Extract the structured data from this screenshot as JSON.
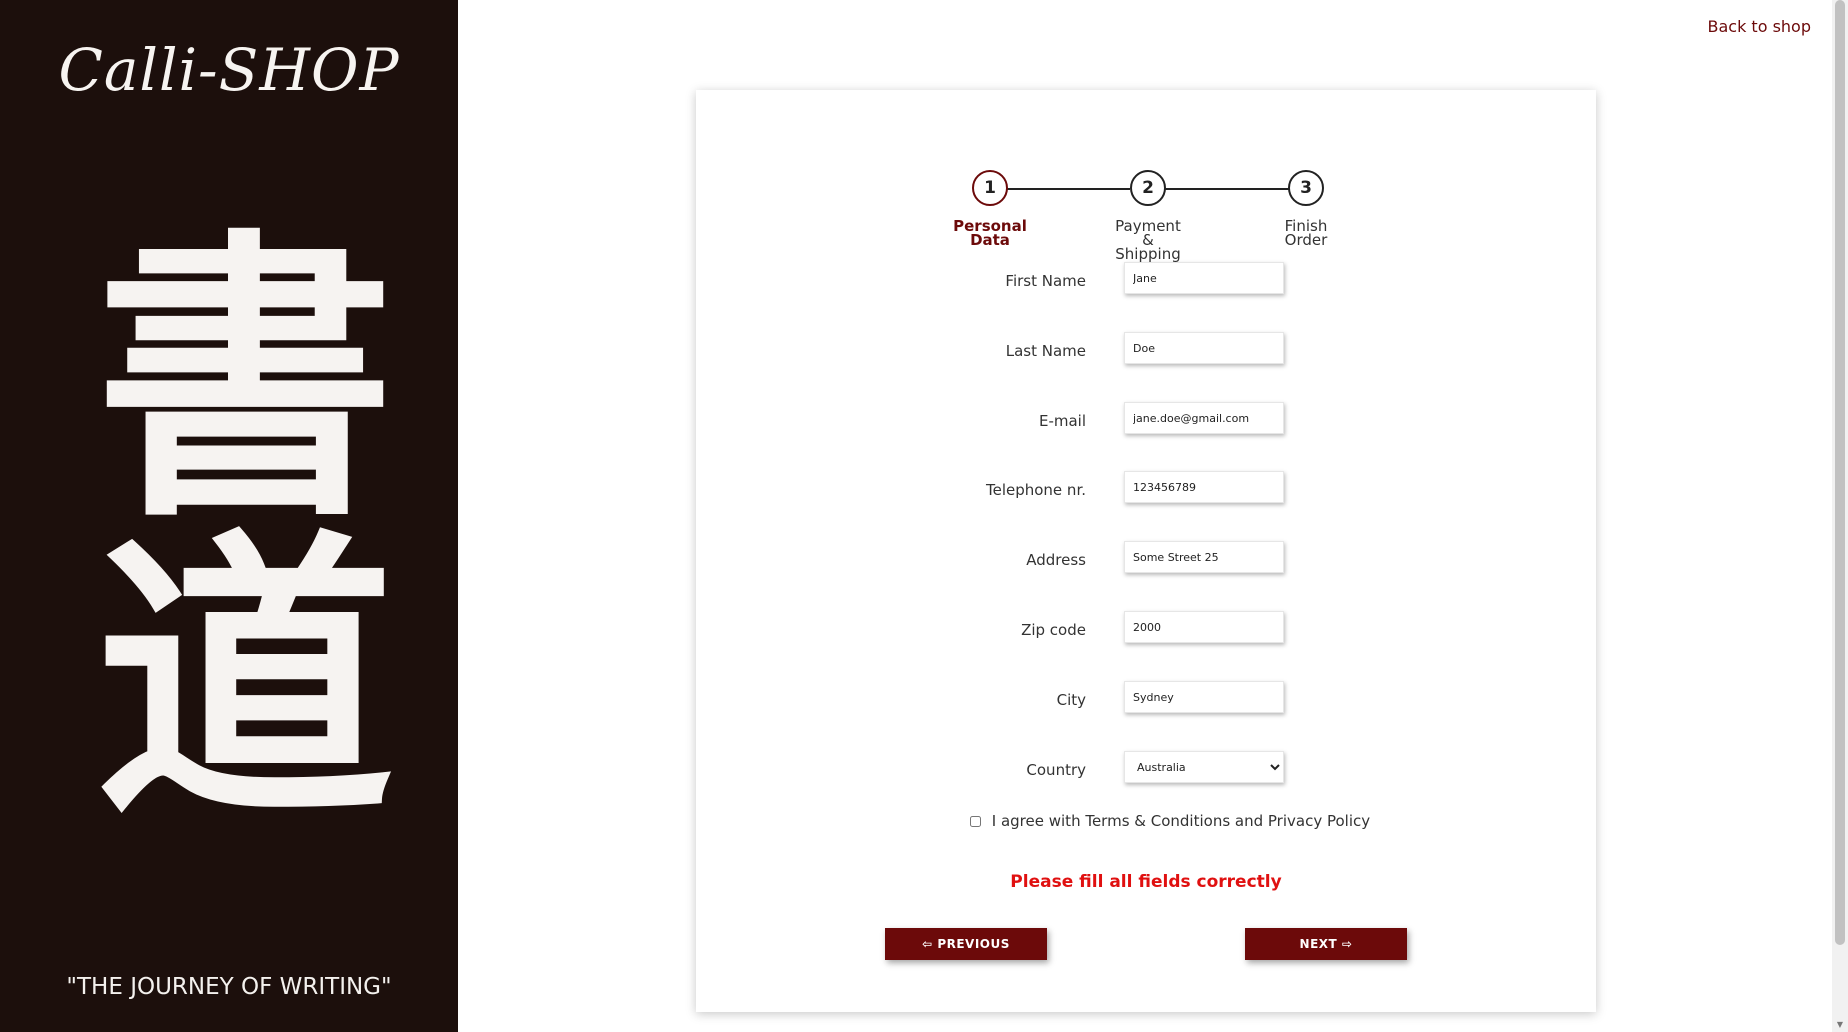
{
  "brand": {
    "title": "Calli-SHOP",
    "calligraphy": "書道",
    "tagline": "\"THE JOURNEY OF WRITING\""
  },
  "nav": {
    "back_link": "Back to shop"
  },
  "stepper": {
    "steps": [
      {
        "number": "1",
        "label": "Personal\nData",
        "active": true
      },
      {
        "number": "2",
        "label": "Payment\n&\nShipping",
        "active": false
      },
      {
        "number": "3",
        "label": "Finish\nOrder",
        "active": false
      }
    ]
  },
  "form": {
    "first_name": {
      "label": "First Name",
      "value": "Jane"
    },
    "last_name": {
      "label": "Last Name",
      "value": "Doe"
    },
    "email": {
      "label": "E-mail",
      "value": "jane.doe@gmail.com"
    },
    "telephone": {
      "label": "Telephone nr.",
      "value": "123456789"
    },
    "address": {
      "label": "Address",
      "value": "Some Street 25"
    },
    "zip": {
      "label": "Zip code",
      "value": "2000"
    },
    "city": {
      "label": "City",
      "value": "Sydney"
    },
    "country": {
      "label": "Country",
      "value": "Australia"
    },
    "agree_label": "I agree with Terms & Conditions and Privacy Policy",
    "agree_checked": false,
    "error": "Please fill all fields correctly",
    "prev_label": "⇦ PREVIOUS",
    "next_label": "NEXT ⇨"
  },
  "colors": {
    "sidebar_bg": "#1c0f0c",
    "accent": "#6c0a0a",
    "error": "#e01010"
  }
}
